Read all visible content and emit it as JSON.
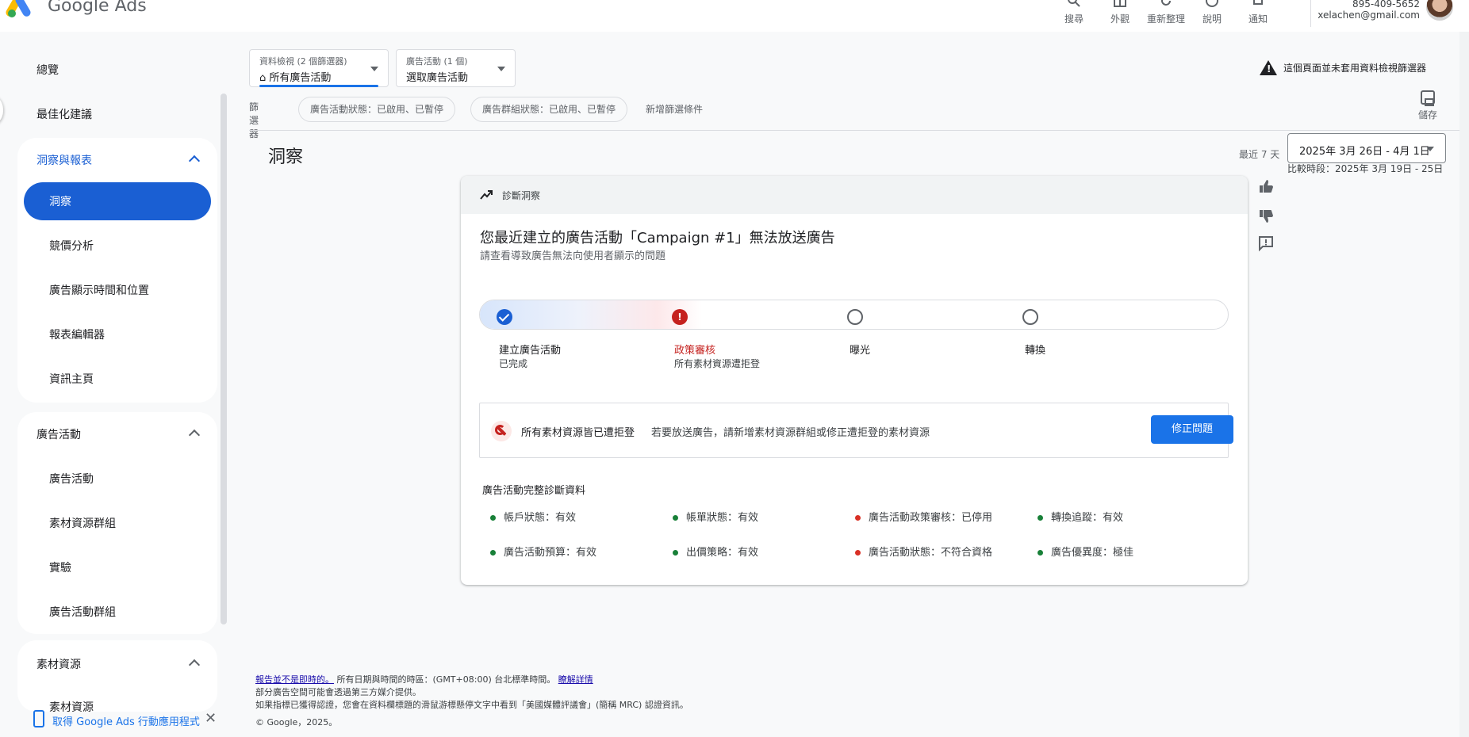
{
  "app": {
    "name": "Google Ads"
  },
  "toolbar": {
    "search": "搜尋",
    "appearance": "外觀",
    "refresh": "重新整理",
    "help": "說明",
    "notifications": "通知"
  },
  "account": {
    "id": "895-409-5652",
    "email": "xelachen@gmail.com"
  },
  "sidebar": {
    "overview": "總覽",
    "recommendations": "最佳化建議",
    "insights_reports": {
      "header": "洞察與報表",
      "items": [
        "洞察",
        "競價分析",
        "廣告顯示時間和位置",
        "報表編輯器",
        "資訊主頁"
      ]
    },
    "campaigns": {
      "header": "廣告活動",
      "items": [
        "廣告活動",
        "素材資源群組",
        "實驗",
        "廣告活動群組"
      ]
    },
    "assets": {
      "header": "素材資源",
      "partial_item": "素材資源"
    },
    "app_banner": "取得 Google Ads 行動應用程式"
  },
  "filters": {
    "view_label": "資料檢視 (2 個篩選器)",
    "view_value": "所有廣告活動",
    "campaign_label": "廣告活動 (1 個)",
    "campaign_value": "選取廣告活動",
    "warning": "這個頁面並未套用資料檢視篩選器",
    "filter_label": "篩選器",
    "chips": [
      "廣告活動狀態：已啟用、已暫停",
      "廣告群組狀態：已啟用、已暫停"
    ],
    "add_filter": "新增篩選條件",
    "save": "儲存"
  },
  "page": {
    "title": "洞察",
    "range_label": "最近 7 天",
    "date_range": "2025年 3月 26日 - 4月 1日",
    "compare": "比較時段：2025年 3月 19日 - 25日"
  },
  "insight": {
    "header": "診斷洞察",
    "title": "您最近建立的廣告活動「Campaign #1」無法放送廣告",
    "subtitle": "請查看導致廣告無法向使用者顯示的問題",
    "steps": [
      {
        "label": "建立廣告活動",
        "sub": "已完成",
        "state": "done"
      },
      {
        "label": "政策審核",
        "sub": "所有素材資源遭拒登",
        "state": "error"
      },
      {
        "label": "曝光",
        "sub": "",
        "state": "pending"
      },
      {
        "label": "轉換",
        "sub": "",
        "state": "pending"
      }
    ],
    "alert_title": "所有素材資源皆已遭拒登",
    "alert_text": "若要放送廣告，請新增素材資源群組或修正遭拒登的素材資源",
    "fix_button": "修正問題",
    "diag_title": "廣告活動完整診斷資料",
    "diagnostics": [
      {
        "text": "帳戶狀態：有效",
        "status": "ok"
      },
      {
        "text": "帳單狀態：有效",
        "status": "ok"
      },
      {
        "text": "廣告活動政策審核：已停用",
        "status": "bad"
      },
      {
        "text": "轉換追蹤：有效",
        "status": "ok"
      },
      {
        "text": "廣告活動預算：有效",
        "status": "ok"
      },
      {
        "text": "出價策略：有效",
        "status": "ok"
      },
      {
        "text": "廣告活動狀態：不符合資格",
        "status": "bad"
      },
      {
        "text": "廣告優異度：極佳",
        "status": "ok"
      }
    ]
  },
  "footer": {
    "not_realtime": "報告並不是即時的。",
    "timezone": "所有日期與時間的時區：(GMT+08:00) 台北標準時間。",
    "learn_more": "瞭解詳情",
    "line2": "部分廣告空間可能會透過第三方媒介提供。",
    "line3": "如果指標已獲得認證，您會在資料欄標題的滑鼠游標懸停文字中看到「美國媒體評議會」(簡稱 MRC) 認證資訊。",
    "copyright": "© Google，2025。"
  },
  "colors": {
    "accent": "#1a73e8",
    "active_nav": "#1a5fd3",
    "error": "#c5221f",
    "ok": "#188038"
  }
}
